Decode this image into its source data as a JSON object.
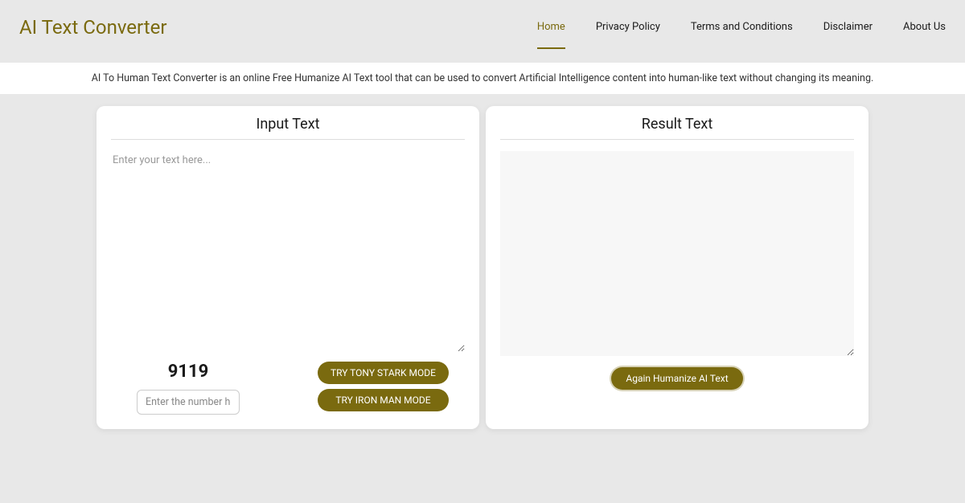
{
  "header": {
    "logo": "AI Text Converter",
    "nav": [
      {
        "label": "Home",
        "active": true
      },
      {
        "label": "Privacy Policy",
        "active": false
      },
      {
        "label": "Terms and Conditions",
        "active": false
      },
      {
        "label": "Disclaimer",
        "active": false
      },
      {
        "label": "About Us",
        "active": false
      }
    ]
  },
  "description": "AI To Human Text Converter is an online Free Humanize AI Text tool that can be used to convert Artificial Intelligence content into human-like text without changing its meaning.",
  "input_panel": {
    "title": "Input Text",
    "textarea_placeholder": "Enter your text here...",
    "textarea_value": "",
    "captcha_number": "9119",
    "captcha_placeholder": "Enter the number here",
    "captcha_value": "",
    "button_tony": "TRY TONY STARK MODE",
    "button_iron": "TRY IRON MAN MODE"
  },
  "result_panel": {
    "title": "Result Text",
    "textarea_value": "",
    "button_again": "Again Humanize AI Text"
  }
}
